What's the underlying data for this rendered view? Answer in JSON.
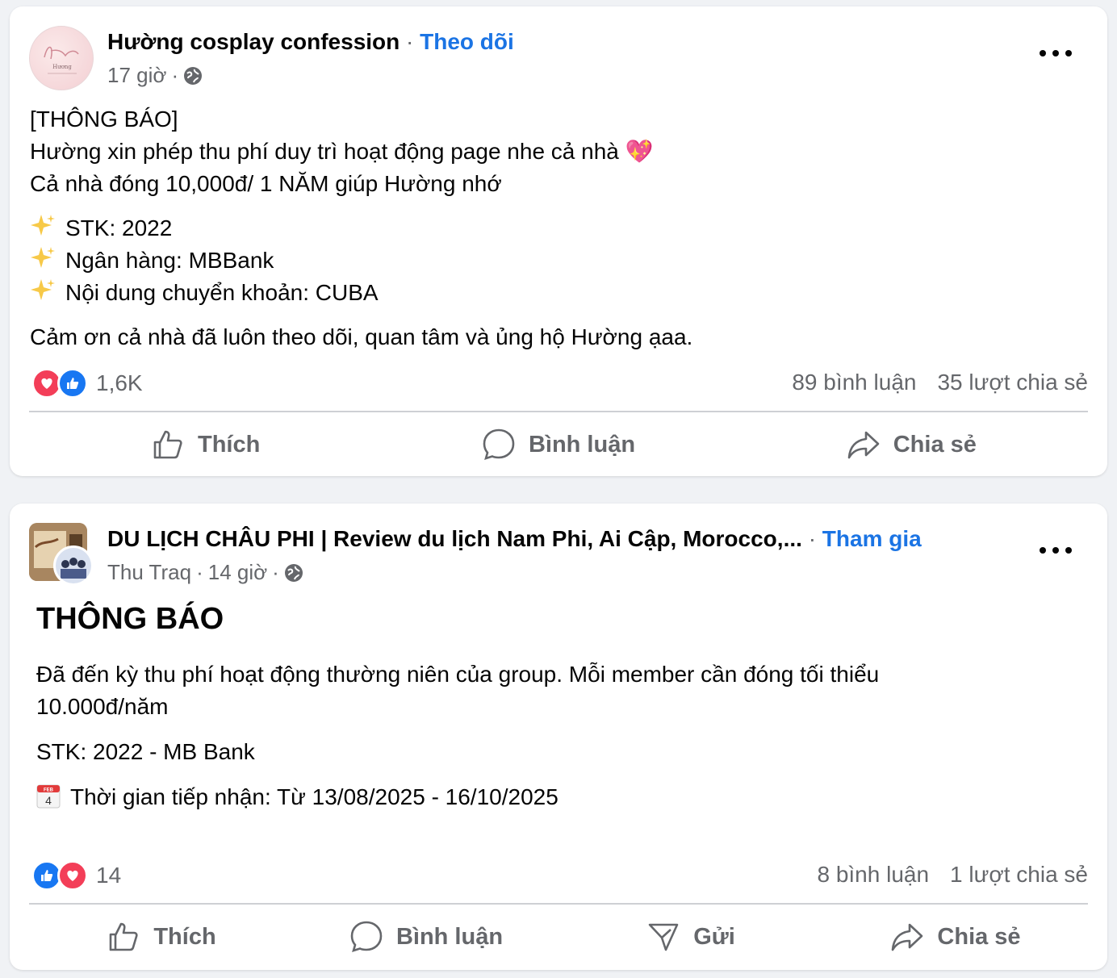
{
  "posts": [
    {
      "page_name": "Hường cosplay confession",
      "separator": "·",
      "follow_label": "Theo dõi",
      "time": "17 giờ",
      "meta_sep": "·",
      "avatar_text": "Hương",
      "lines": [
        "[THÔNG BÁO]",
        "Hường xin phép thu phí duy trì hoạt động page nhe cả nhà 💖",
        "Cả nhà đóng 10,000đ/ 1 NĂM giúp Hường nhớ",
        "STK: 2022",
        "Ngân hàng: MBBank",
        "Nội dung chuyển khoản: CUBA",
        "Cảm ơn cả nhà đã luôn theo dõi, quan tâm và ủng hộ Hường ạaa."
      ],
      "reaction_count": "1,6K",
      "comments": "89 bình luận",
      "shares": "35 lượt chia sẻ",
      "actions": [
        "Thích",
        "Bình luận",
        "Chia sẻ"
      ]
    },
    {
      "page_name": "DU LỊCH CHÂU PHI | Review du lịch Nam Phi, Ai Cập, Morocco,...",
      "separator": "·",
      "follow_label": "Tham gia",
      "author": "Thu Traq",
      "meta_sep1": "·",
      "time": "14 giờ",
      "meta_sep2": "·",
      "title": "THÔNG BÁO",
      "lines": [
        "Đã đến kỳ thu phí hoạt động thường niên của group. Mỗi member cần đóng tối thiểu",
        "10.000đ/năm",
        "STK: 2022 - MB Bank",
        "Thời gian tiếp nhận: Từ 13/08/2025 - 16/10/2025"
      ],
      "calendar_month": "FEB",
      "calendar_day": "4",
      "reaction_count": "14",
      "comments": "8 bình luận",
      "shares": "1 lượt chia sẻ",
      "actions": [
        "Thích",
        "Bình luận",
        "Gửi",
        "Chia sẻ"
      ]
    }
  ],
  "colors": {
    "accent": "#1b74e4",
    "secondary_text": "#65676b",
    "heart": "#f33e58",
    "like": "#1877f2",
    "background": "#f0f2f5"
  },
  "icons": [
    "globe-icon",
    "more-icon",
    "heart-reaction-icon",
    "like-reaction-icon",
    "like-icon",
    "comment-icon",
    "share-icon",
    "send-icon",
    "sparkles-icon",
    "calendar-icon"
  ]
}
